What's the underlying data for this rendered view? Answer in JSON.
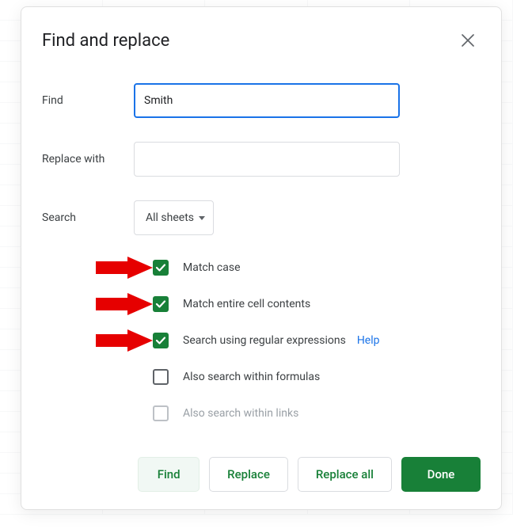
{
  "dialog": {
    "title": "Find and replace",
    "find_label": "Find",
    "find_value": "Smith",
    "replace_label": "Replace with",
    "replace_value": "",
    "search_label": "Search",
    "search_scope": "All sheets",
    "options": {
      "match_case": "Match case",
      "match_entire": "Match entire cell contents",
      "regex": "Search using regular expressions",
      "help": "Help",
      "within_formulas": "Also search within formulas",
      "within_links": "Also search within links"
    },
    "buttons": {
      "find": "Find",
      "replace": "Replace",
      "replace_all": "Replace all",
      "done": "Done"
    }
  }
}
